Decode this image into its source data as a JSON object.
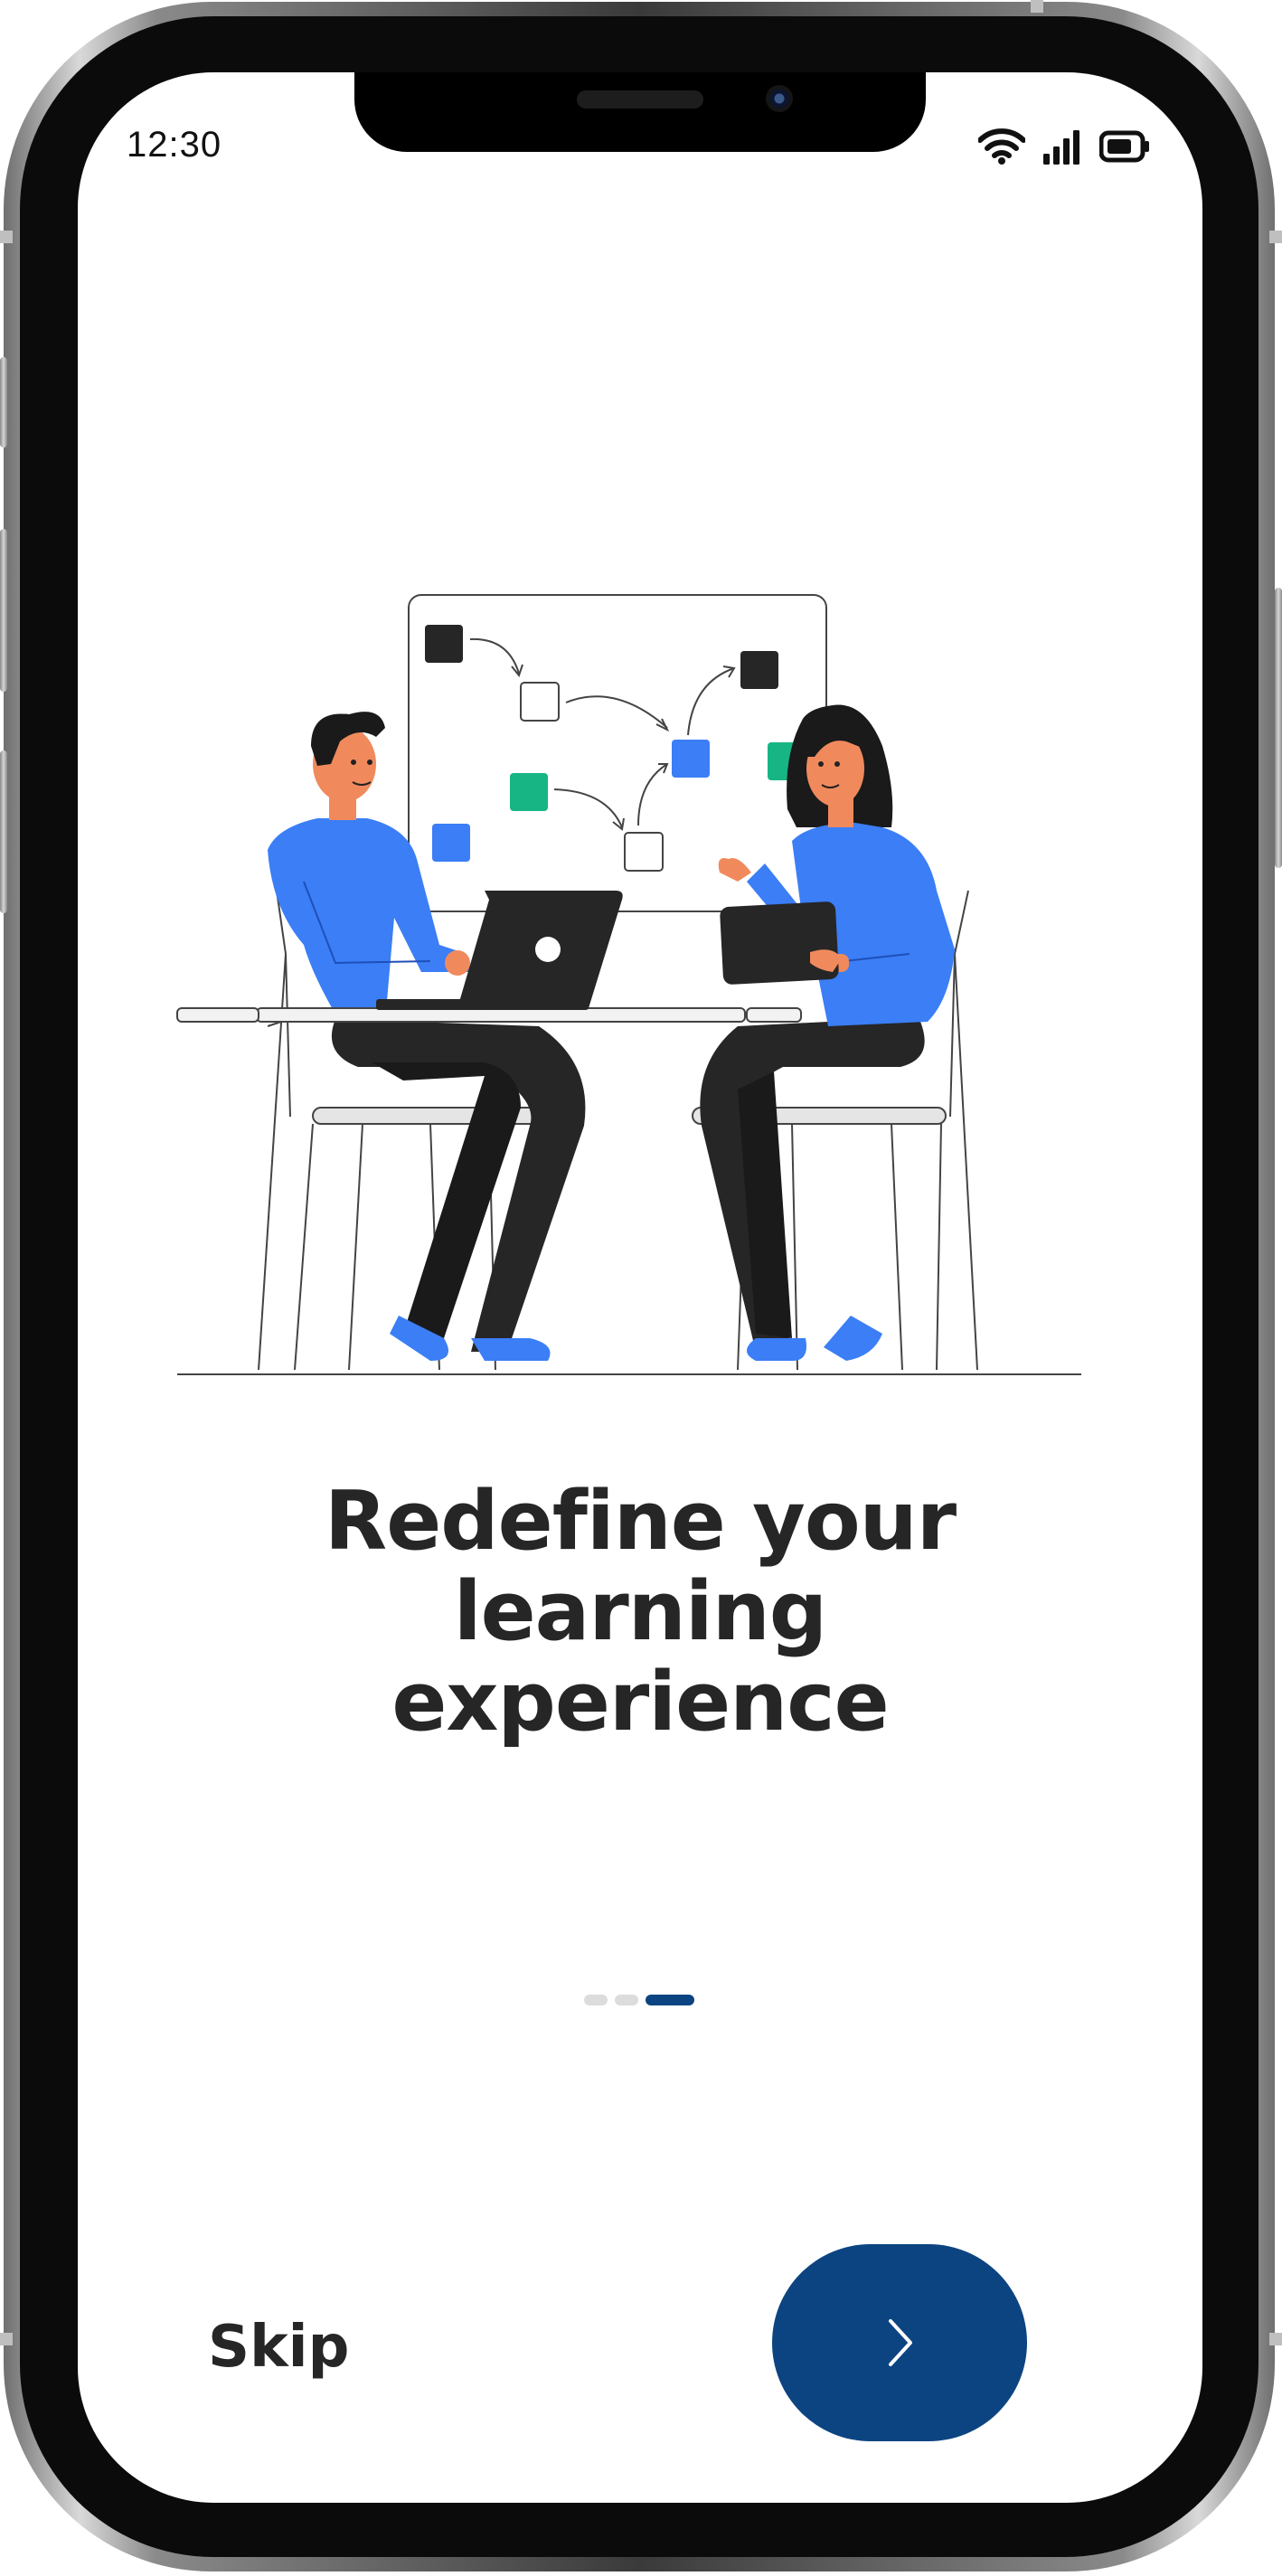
{
  "status_bar": {
    "time": "12:30",
    "icons": [
      "wifi-icon",
      "cellular-signal-icon",
      "battery-icon"
    ]
  },
  "onboarding": {
    "illustration": "two-people-collaborating-at-table",
    "title_lines": [
      "Redefine your",
      "learning",
      "experience"
    ],
    "pagination": {
      "total": 3,
      "active": 3
    },
    "skip_label": "Skip",
    "next_icon": "chevron-right-icon"
  },
  "colors": {
    "primary": "#0c4481",
    "illustration_blue": "#3b7ef6",
    "illustration_green": "#17b584",
    "text": "#262626",
    "dot_inactive": "#dcdcdc"
  }
}
